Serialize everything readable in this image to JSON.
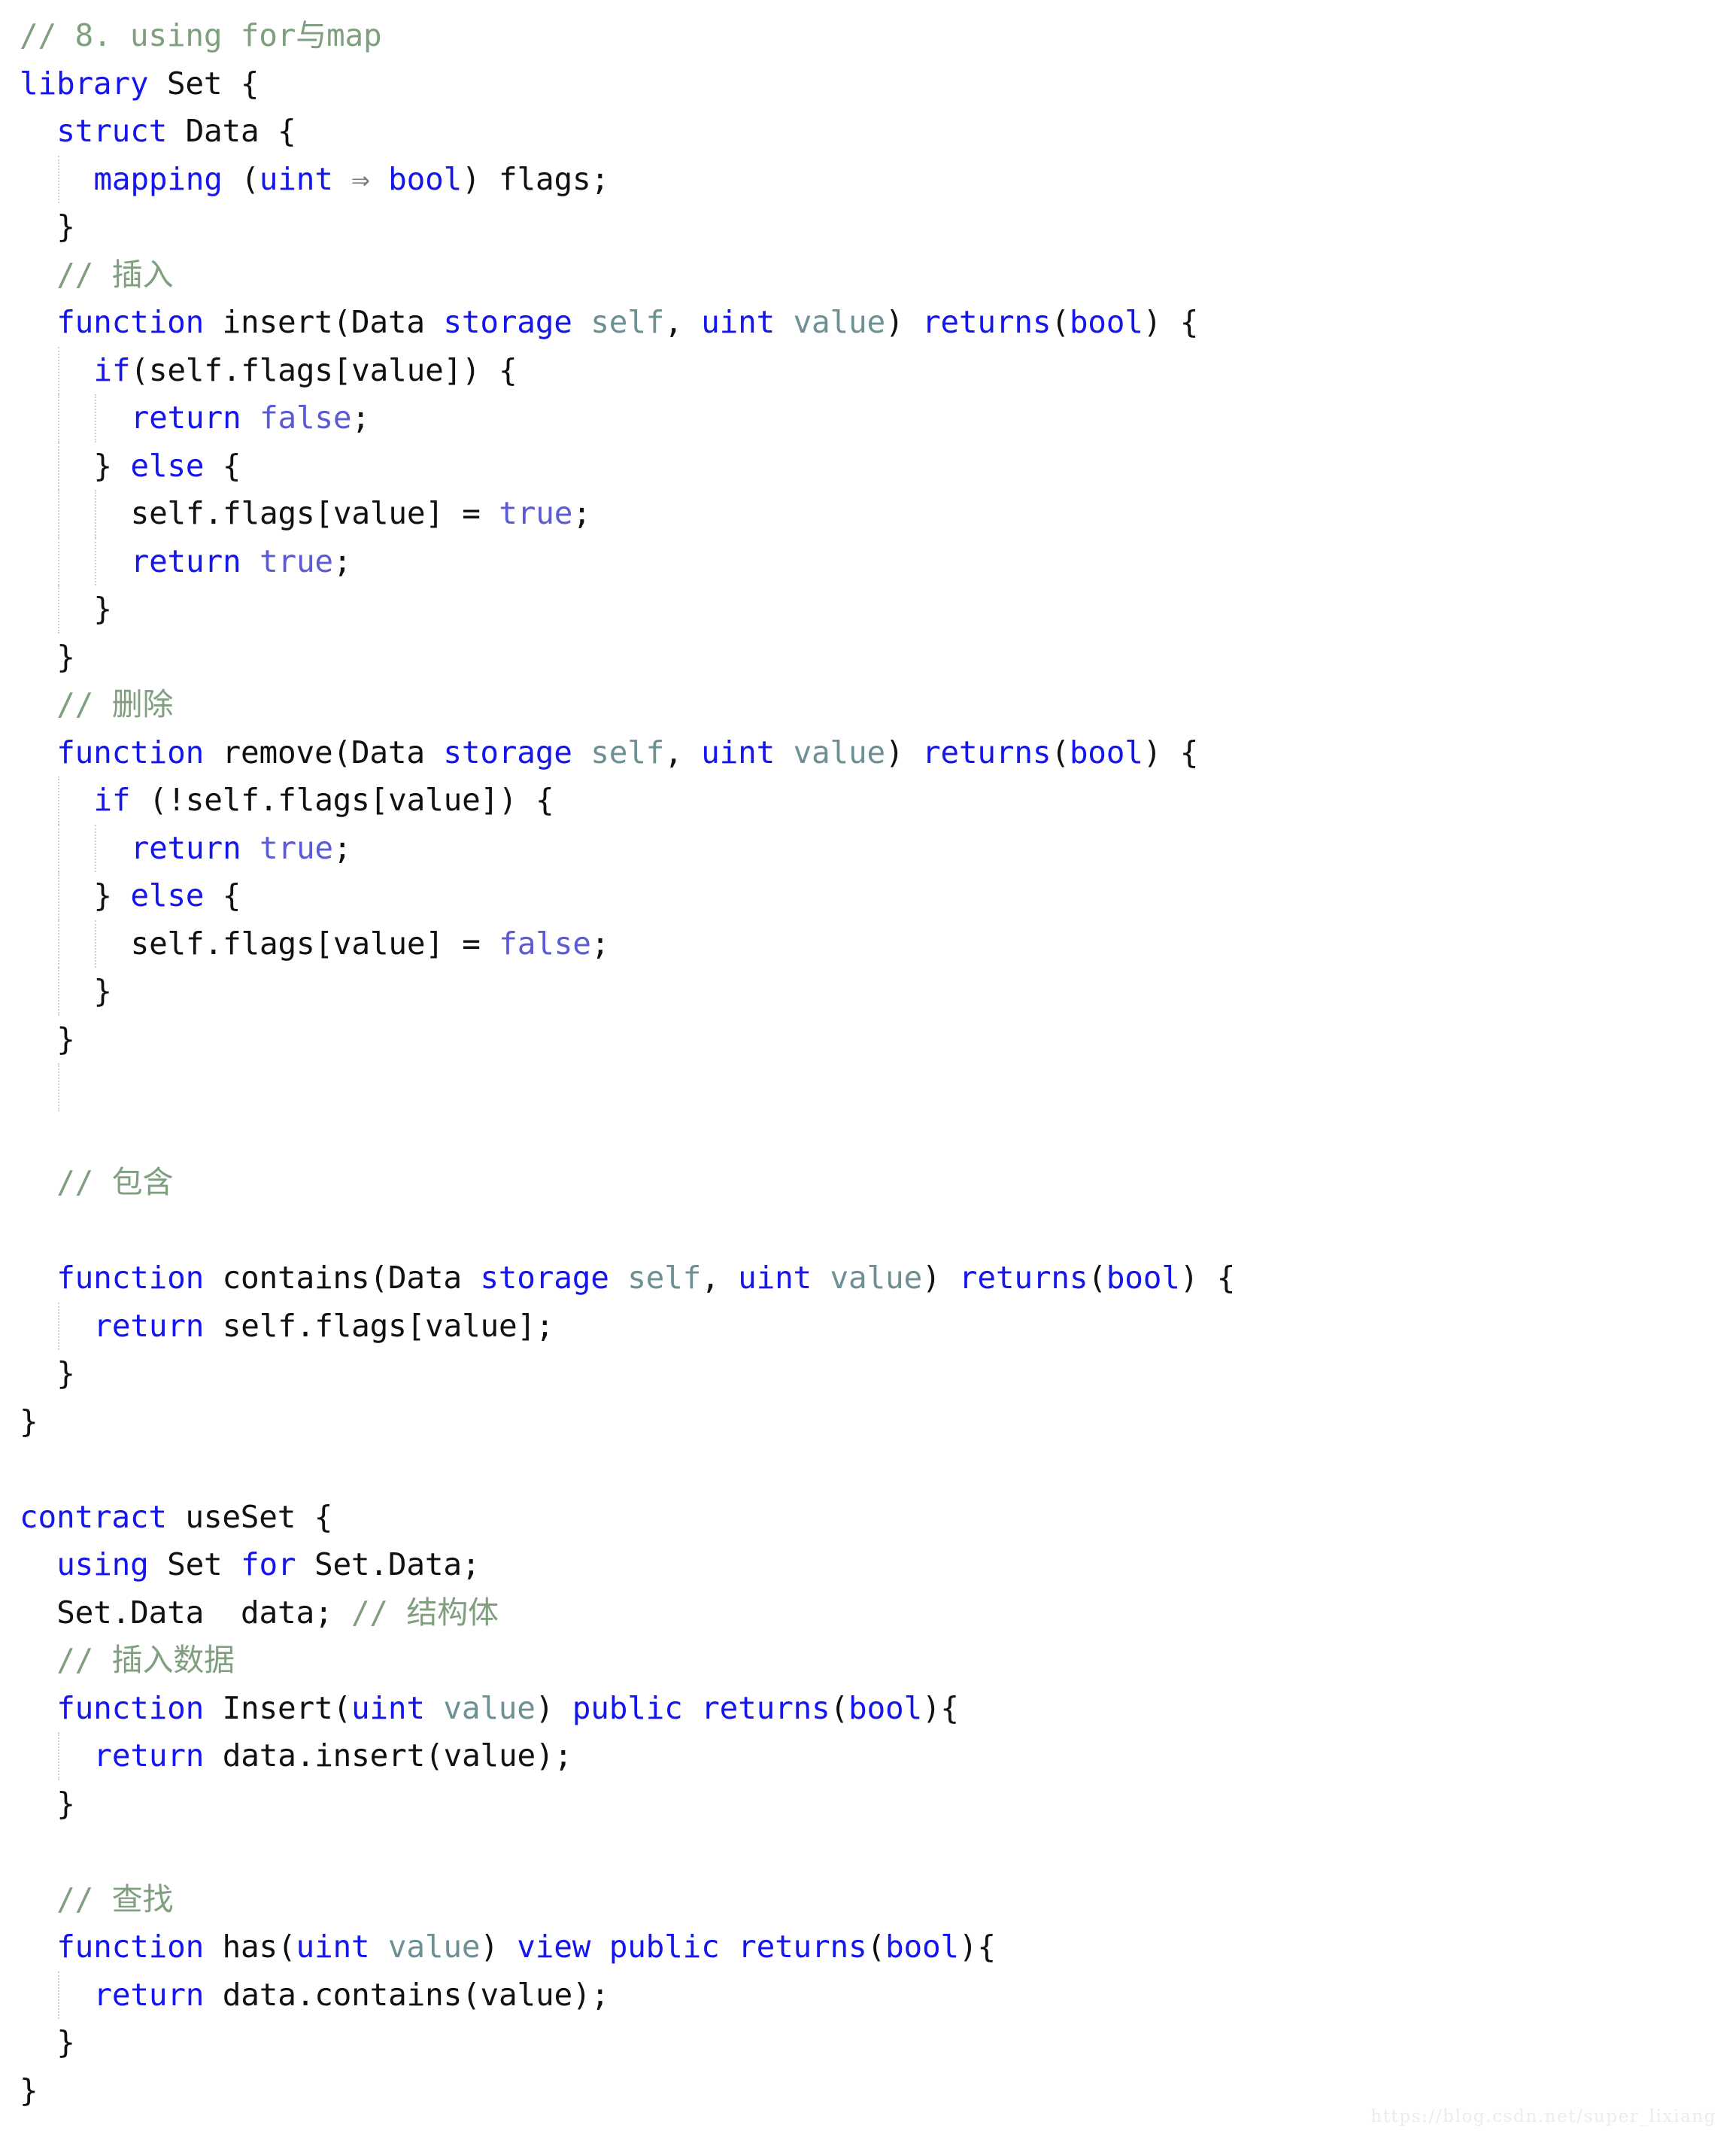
{
  "document": {
    "kind": "source-code-screenshot",
    "language": "Solidity",
    "watermark": "https://blog.csdn.net/super_lixiang",
    "colors": {
      "background": "#ffffff",
      "gutter": "#eceefa",
      "keyword": "#1515ee",
      "plain": "#111111",
      "literal": "#5b5bd6",
      "parameter": "#6d9094",
      "comment": "#7f9f7f",
      "indent_guide": "#cfcfcf",
      "watermark": "#ececec"
    }
  },
  "code": {
    "lines": [
      {
        "indent": 0,
        "guides": [],
        "tokens": [
          {
            "t": "// 8. using for与map",
            "c": "cmt"
          }
        ]
      },
      {
        "indent": 0,
        "guides": [],
        "tokens": [
          {
            "t": "library",
            "c": "kw"
          },
          {
            "t": " Set {",
            "c": "pln"
          }
        ]
      },
      {
        "indent": 2,
        "guides": [],
        "tokens": [
          {
            "t": "struct",
            "c": "kw"
          },
          {
            "t": " Data {",
            "c": "pln"
          }
        ]
      },
      {
        "indent": 4,
        "guides": [
          2
        ],
        "tokens": [
          {
            "t": "mapping",
            "c": "kw"
          },
          {
            "t": " (",
            "c": "pln"
          },
          {
            "t": "uint",
            "c": "kw"
          },
          {
            "t": " ⇒ ",
            "c": "arrow"
          },
          {
            "t": "bool",
            "c": "kw"
          },
          {
            "t": ") flags;",
            "c": "pln"
          }
        ]
      },
      {
        "indent": 2,
        "guides": [],
        "tokens": [
          {
            "t": "}",
            "c": "pln"
          }
        ]
      },
      {
        "indent": 2,
        "guides": [],
        "tokens": [
          {
            "t": "// 插入",
            "c": "cmt"
          }
        ]
      },
      {
        "indent": 2,
        "guides": [],
        "tokens": [
          {
            "t": "function",
            "c": "kw"
          },
          {
            "t": " insert(Data ",
            "c": "pln"
          },
          {
            "t": "storage",
            "c": "kw"
          },
          {
            "t": " ",
            "c": "pln"
          },
          {
            "t": "self",
            "c": "par"
          },
          {
            "t": ", ",
            "c": "pln"
          },
          {
            "t": "uint",
            "c": "kw"
          },
          {
            "t": " ",
            "c": "pln"
          },
          {
            "t": "value",
            "c": "par"
          },
          {
            "t": ") ",
            "c": "pln"
          },
          {
            "t": "returns",
            "c": "kw"
          },
          {
            "t": "(",
            "c": "pln"
          },
          {
            "t": "bool",
            "c": "kw"
          },
          {
            "t": ") {",
            "c": "pln"
          }
        ]
      },
      {
        "indent": 4,
        "guides": [
          2
        ],
        "tokens": [
          {
            "t": "if",
            "c": "kw"
          },
          {
            "t": "(self.flags[value]) {",
            "c": "pln"
          }
        ]
      },
      {
        "indent": 6,
        "guides": [
          2,
          4
        ],
        "tokens": [
          {
            "t": "return",
            "c": "kw"
          },
          {
            "t": " ",
            "c": "pln"
          },
          {
            "t": "false",
            "c": "lit"
          },
          {
            "t": ";",
            "c": "pln"
          }
        ]
      },
      {
        "indent": 4,
        "guides": [
          2
        ],
        "tokens": [
          {
            "t": "} ",
            "c": "pln"
          },
          {
            "t": "else",
            "c": "kw"
          },
          {
            "t": " {",
            "c": "pln"
          }
        ]
      },
      {
        "indent": 6,
        "guides": [
          2,
          4
        ],
        "tokens": [
          {
            "t": "self.flags[value] = ",
            "c": "pln"
          },
          {
            "t": "true",
            "c": "lit"
          },
          {
            "t": ";",
            "c": "pln"
          }
        ]
      },
      {
        "indent": 6,
        "guides": [
          2,
          4
        ],
        "tokens": [
          {
            "t": "return",
            "c": "kw"
          },
          {
            "t": " ",
            "c": "pln"
          },
          {
            "t": "true",
            "c": "lit"
          },
          {
            "t": ";",
            "c": "pln"
          }
        ]
      },
      {
        "indent": 4,
        "guides": [
          2
        ],
        "tokens": [
          {
            "t": "}",
            "c": "pln"
          }
        ]
      },
      {
        "indent": 2,
        "guides": [],
        "tokens": [
          {
            "t": "}",
            "c": "pln"
          }
        ]
      },
      {
        "indent": 2,
        "guides": [],
        "tokens": [
          {
            "t": "// 删除",
            "c": "cmt"
          }
        ]
      },
      {
        "indent": 2,
        "guides": [],
        "tokens": [
          {
            "t": "function",
            "c": "kw"
          },
          {
            "t": " remove(Data ",
            "c": "pln"
          },
          {
            "t": "storage",
            "c": "kw"
          },
          {
            "t": " ",
            "c": "pln"
          },
          {
            "t": "self",
            "c": "par"
          },
          {
            "t": ", ",
            "c": "pln"
          },
          {
            "t": "uint",
            "c": "kw"
          },
          {
            "t": " ",
            "c": "pln"
          },
          {
            "t": "value",
            "c": "par"
          },
          {
            "t": ") ",
            "c": "pln"
          },
          {
            "t": "returns",
            "c": "kw"
          },
          {
            "t": "(",
            "c": "pln"
          },
          {
            "t": "bool",
            "c": "kw"
          },
          {
            "t": ") {",
            "c": "pln"
          }
        ]
      },
      {
        "indent": 4,
        "guides": [
          2
        ],
        "tokens": [
          {
            "t": "if",
            "c": "kw"
          },
          {
            "t": " (!self.flags[value]) {",
            "c": "pln"
          }
        ]
      },
      {
        "indent": 6,
        "guides": [
          2,
          4
        ],
        "tokens": [
          {
            "t": "return",
            "c": "kw"
          },
          {
            "t": " ",
            "c": "pln"
          },
          {
            "t": "true",
            "c": "lit"
          },
          {
            "t": ";",
            "c": "pln"
          }
        ]
      },
      {
        "indent": 4,
        "guides": [
          2
        ],
        "tokens": [
          {
            "t": "} ",
            "c": "pln"
          },
          {
            "t": "else",
            "c": "kw"
          },
          {
            "t": " {",
            "c": "pln"
          }
        ]
      },
      {
        "indent": 6,
        "guides": [
          2,
          4
        ],
        "tokens": [
          {
            "t": "self.flags[value] = ",
            "c": "pln"
          },
          {
            "t": "false",
            "c": "lit"
          },
          {
            "t": ";",
            "c": "pln"
          }
        ]
      },
      {
        "indent": 4,
        "guides": [
          2
        ],
        "tokens": [
          {
            "t": "}",
            "c": "pln"
          }
        ]
      },
      {
        "indent": 2,
        "guides": [],
        "tokens": [
          {
            "t": "}",
            "c": "pln"
          }
        ]
      },
      {
        "indent": 0,
        "guides": [
          2
        ],
        "tokens": []
      },
      {
        "indent": 0,
        "guides": [],
        "tokens": []
      },
      {
        "indent": 2,
        "guides": [],
        "tokens": [
          {
            "t": "// 包含",
            "c": "cmt"
          }
        ]
      },
      {
        "indent": 0,
        "guides": [],
        "tokens": []
      },
      {
        "indent": 2,
        "guides": [],
        "tokens": [
          {
            "t": "function",
            "c": "kw"
          },
          {
            "t": " contains(Data ",
            "c": "pln"
          },
          {
            "t": "storage",
            "c": "kw"
          },
          {
            "t": " ",
            "c": "pln"
          },
          {
            "t": "self",
            "c": "par"
          },
          {
            "t": ", ",
            "c": "pln"
          },
          {
            "t": "uint",
            "c": "kw"
          },
          {
            "t": " ",
            "c": "pln"
          },
          {
            "t": "value",
            "c": "par"
          },
          {
            "t": ") ",
            "c": "pln"
          },
          {
            "t": "returns",
            "c": "kw"
          },
          {
            "t": "(",
            "c": "pln"
          },
          {
            "t": "bool",
            "c": "kw"
          },
          {
            "t": ") {",
            "c": "pln"
          }
        ]
      },
      {
        "indent": 4,
        "guides": [
          2
        ],
        "tokens": [
          {
            "t": "return",
            "c": "kw"
          },
          {
            "t": " self.flags[value];",
            "c": "pln"
          }
        ]
      },
      {
        "indent": 2,
        "guides": [],
        "tokens": [
          {
            "t": "}",
            "c": "pln"
          }
        ]
      },
      {
        "indent": 0,
        "guides": [],
        "tokens": [
          {
            "t": "}",
            "c": "pln"
          }
        ]
      },
      {
        "indent": 0,
        "guides": [],
        "tokens": []
      },
      {
        "indent": 0,
        "guides": [],
        "tokens": [
          {
            "t": "contract",
            "c": "kw"
          },
          {
            "t": " useSet {",
            "c": "pln"
          }
        ]
      },
      {
        "indent": 2,
        "guides": [],
        "tokens": [
          {
            "t": "using",
            "c": "kw"
          },
          {
            "t": " Set ",
            "c": "pln"
          },
          {
            "t": "for",
            "c": "kw"
          },
          {
            "t": " Set.Data;",
            "c": "pln"
          }
        ]
      },
      {
        "indent": 2,
        "guides": [],
        "tokens": [
          {
            "t": "Set.Data  data; ",
            "c": "pln"
          },
          {
            "t": "// 结构体",
            "c": "cmt"
          }
        ]
      },
      {
        "indent": 2,
        "guides": [],
        "tokens": [
          {
            "t": "// 插入数据",
            "c": "cmt"
          }
        ]
      },
      {
        "indent": 2,
        "guides": [],
        "tokens": [
          {
            "t": "function",
            "c": "kw"
          },
          {
            "t": " Insert(",
            "c": "pln"
          },
          {
            "t": "uint",
            "c": "kw"
          },
          {
            "t": " ",
            "c": "pln"
          },
          {
            "t": "value",
            "c": "par"
          },
          {
            "t": ") ",
            "c": "pln"
          },
          {
            "t": "public",
            "c": "kw"
          },
          {
            "t": " ",
            "c": "pln"
          },
          {
            "t": "returns",
            "c": "kw"
          },
          {
            "t": "(",
            "c": "pln"
          },
          {
            "t": "bool",
            "c": "kw"
          },
          {
            "t": "){",
            "c": "pln"
          }
        ]
      },
      {
        "indent": 4,
        "guides": [
          2
        ],
        "tokens": [
          {
            "t": "return",
            "c": "kw"
          },
          {
            "t": " data.insert(value);",
            "c": "pln"
          }
        ]
      },
      {
        "indent": 2,
        "guides": [],
        "tokens": [
          {
            "t": "}",
            "c": "pln"
          }
        ]
      },
      {
        "indent": 0,
        "guides": [],
        "tokens": []
      },
      {
        "indent": 2,
        "guides": [],
        "tokens": [
          {
            "t": "// 查找",
            "c": "cmt"
          }
        ]
      },
      {
        "indent": 2,
        "guides": [],
        "tokens": [
          {
            "t": "function",
            "c": "kw"
          },
          {
            "t": " has(",
            "c": "pln"
          },
          {
            "t": "uint",
            "c": "kw"
          },
          {
            "t": " ",
            "c": "pln"
          },
          {
            "t": "value",
            "c": "par"
          },
          {
            "t": ") ",
            "c": "pln"
          },
          {
            "t": "view",
            "c": "kw"
          },
          {
            "t": " ",
            "c": "pln"
          },
          {
            "t": "public",
            "c": "kw"
          },
          {
            "t": " ",
            "c": "pln"
          },
          {
            "t": "returns",
            "c": "kw"
          },
          {
            "t": "(",
            "c": "pln"
          },
          {
            "t": "bool",
            "c": "kw"
          },
          {
            "t": "){",
            "c": "pln"
          }
        ]
      },
      {
        "indent": 4,
        "guides": [
          2
        ],
        "tokens": [
          {
            "t": "return",
            "c": "kw"
          },
          {
            "t": " data.contains(value);",
            "c": "pln"
          }
        ]
      },
      {
        "indent": 2,
        "guides": [],
        "tokens": [
          {
            "t": "}",
            "c": "pln"
          }
        ]
      },
      {
        "indent": 0,
        "guides": [],
        "tokens": [
          {
            "t": "}",
            "c": "pln"
          }
        ]
      }
    ]
  }
}
